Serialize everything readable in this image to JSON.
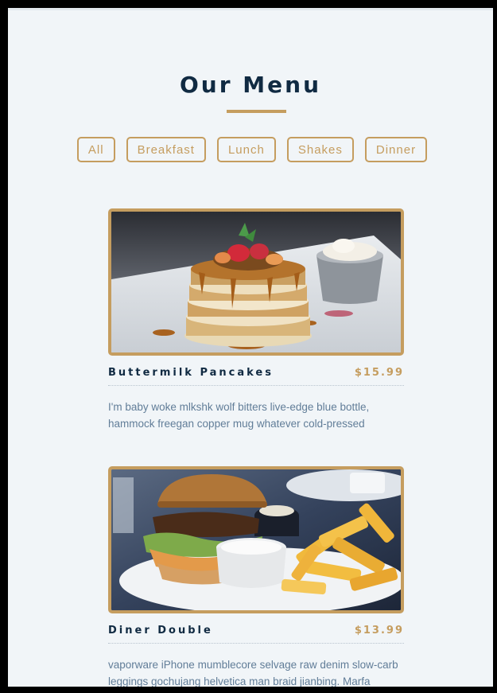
{
  "header": {
    "title": "Our Menu"
  },
  "filters": [
    "All",
    "Breakfast",
    "Lunch",
    "Shakes",
    "Dinner"
  ],
  "items": [
    {
      "name": "Buttermilk Pancakes",
      "price": "$15.99",
      "description": "I'm baby woke mlkshk wolf bitters live-edge blue bottle, hammock freegan copper mug whatever cold-pressed",
      "image": "pancake-stack-photo"
    },
    {
      "name": "Diner Double",
      "price": "$13.99",
      "description": "vaporware iPhone mumblecore selvage raw denim slow-carb leggings gochujang helvetica man braid jianbing. Marfa",
      "image": "burger-fries-photo"
    }
  ],
  "colors": {
    "accent": "#c59d5f",
    "heading": "#102a42",
    "text": "#617d98",
    "background": "#f1f5f8"
  }
}
